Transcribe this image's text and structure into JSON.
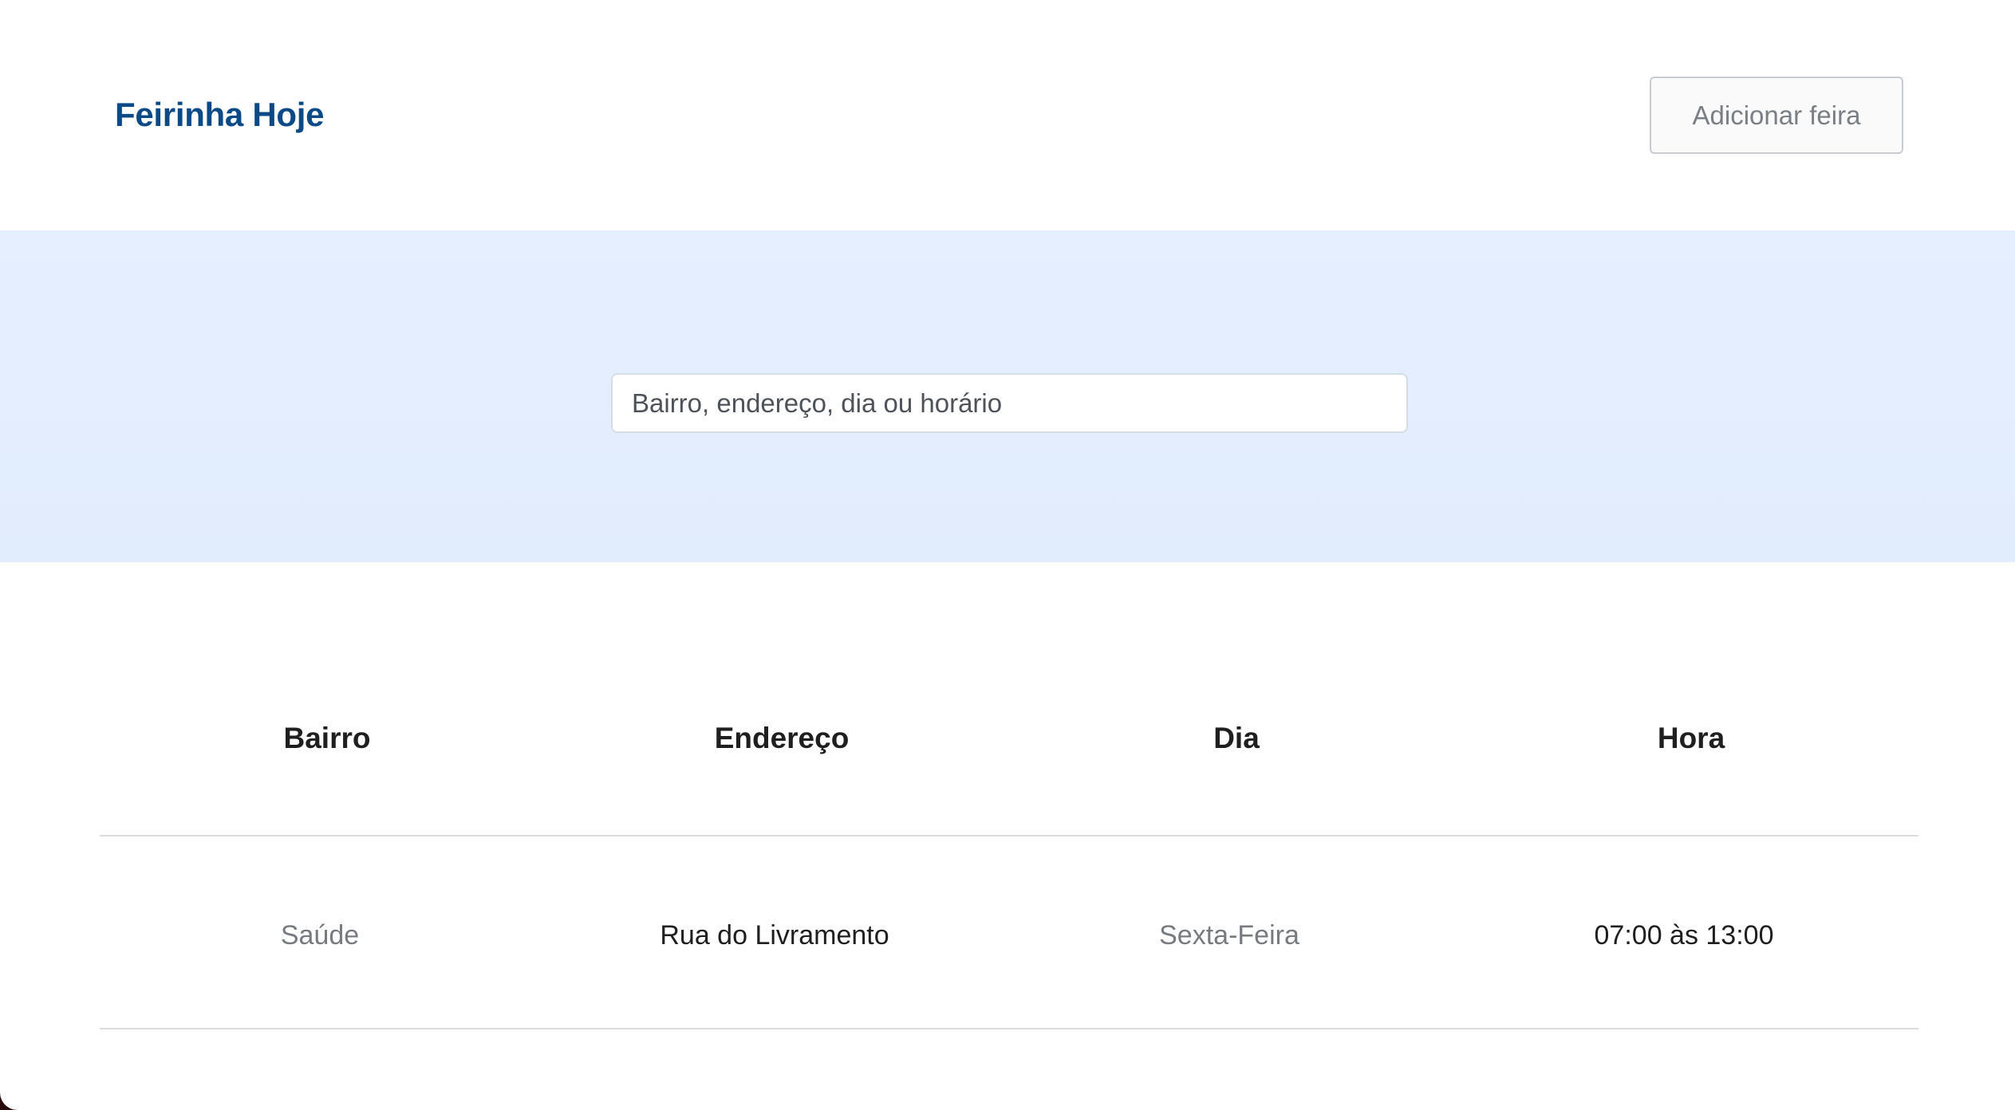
{
  "header": {
    "brand": "Feirinha Hoje",
    "add_button_label": "Adicionar feira"
  },
  "search": {
    "placeholder": "Bairro, endereço, dia ou horário",
    "value": ""
  },
  "table": {
    "columns": [
      "Bairro",
      "Endereço",
      "Dia",
      "Hora"
    ],
    "rows": [
      [
        "Saúde",
        "Rua do Livramento",
        "Sexta-Feira",
        "07:00 às 13:00"
      ]
    ]
  },
  "colors": {
    "brand": "#0b4a86",
    "search_band": "#e4eefe",
    "muted_text": "#777b80"
  }
}
